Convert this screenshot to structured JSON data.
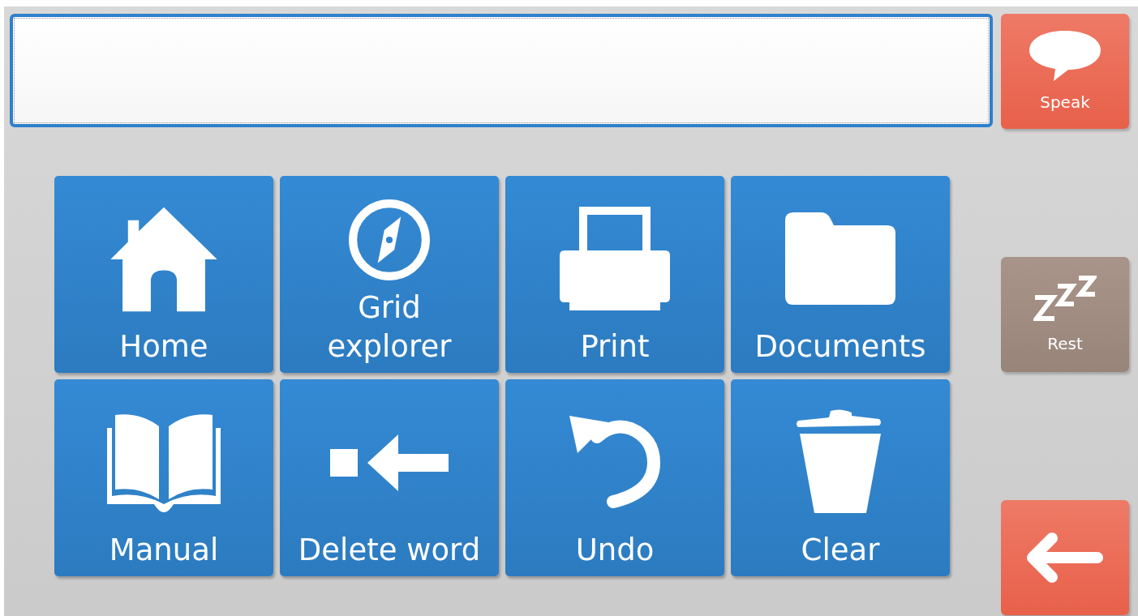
{
  "message_field": {
    "focused": true
  },
  "tiles": [
    {
      "label": "Home",
      "kind": "house"
    },
    {
      "label": "Grid\nexplorer",
      "kind": "compass"
    },
    {
      "label": "Print",
      "kind": "printer"
    },
    {
      "label": "Documents",
      "kind": "folder"
    },
    {
      "label": "Manual",
      "kind": "book"
    },
    {
      "label": "Delete word",
      "kind": "delete-word"
    },
    {
      "label": "Undo",
      "kind": "undo"
    },
    {
      "label": "Clear",
      "kind": "trash"
    }
  ],
  "side_buttons": [
    {
      "kind": "speak",
      "label": "Speak"
    },
    {
      "kind": "rest",
      "label": "Rest"
    },
    {
      "kind": "back"
    }
  ]
}
